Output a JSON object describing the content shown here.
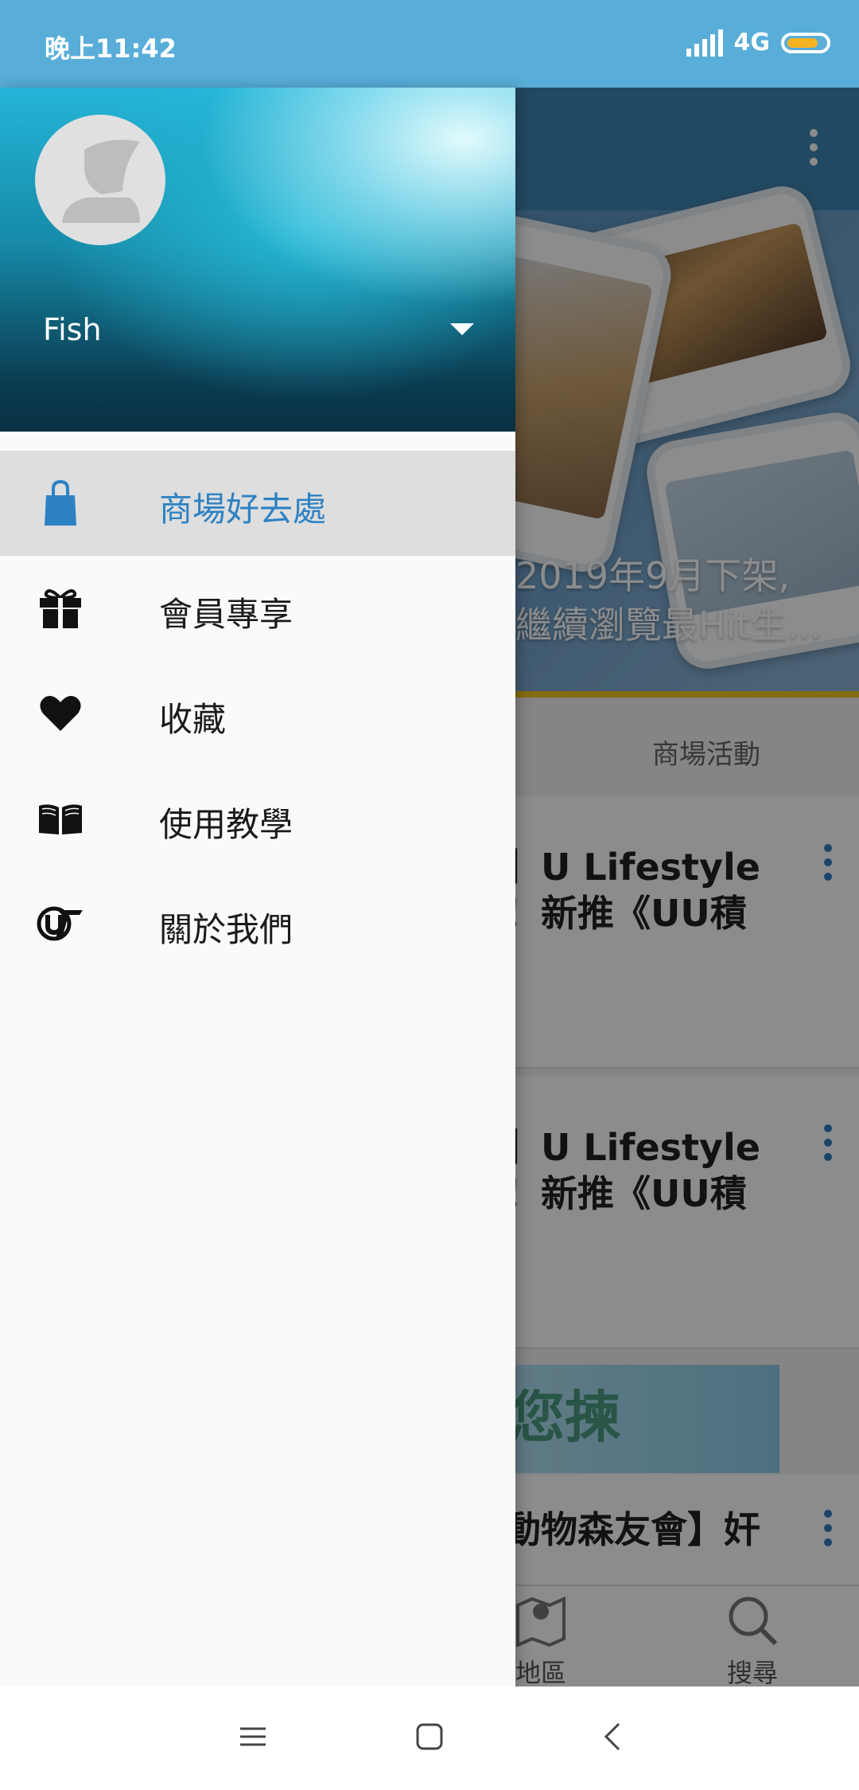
{
  "status_bar": {
    "time": "晚上11:42",
    "network": "4G"
  },
  "background_app": {
    "banner_caption_line1": "2019年9月下架,",
    "banner_caption_line2": "繼續瀏覽最Hit生...",
    "tab_label": "商場活動",
    "cards": [
      {
        "title_line1": "】U Lifestyle",
        "title_line2": "！新推《UU積"
      },
      {
        "title_line1": "】U Lifestyle",
        "title_line2": "！新推《UU積"
      },
      {
        "title_line1": "動物森友會】奸",
        "title_line2": ""
      }
    ],
    "ad_text": "您揀",
    "bottom_nav": [
      {
        "label": "地區",
        "icon": "map-icon"
      },
      {
        "label": "搜尋",
        "icon": "search-icon"
      }
    ]
  },
  "drawer": {
    "username": "Fish",
    "menu": [
      {
        "label": "商場好去處",
        "icon": "shopping-bag-icon",
        "active": true
      },
      {
        "label": "會員專享",
        "icon": "gift-icon",
        "active": false
      },
      {
        "label": "收藏",
        "icon": "heart-icon",
        "active": false
      },
      {
        "label": "使用教學",
        "icon": "book-icon",
        "active": false
      },
      {
        "label": "關於我們",
        "icon": "u-logo-icon",
        "active": false
      }
    ],
    "colors": {
      "active_text": "#2d82c4",
      "active_bg": "#dedede"
    }
  },
  "system_nav": {
    "buttons": [
      "menu",
      "home",
      "back"
    ]
  }
}
